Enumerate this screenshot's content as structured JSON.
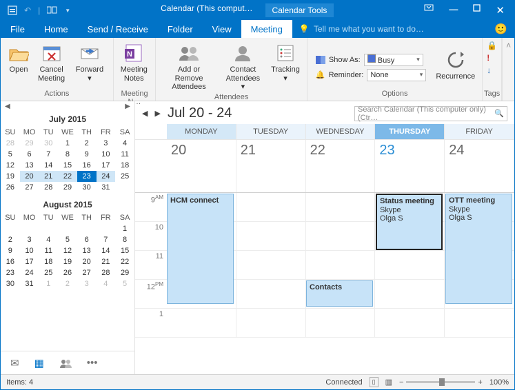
{
  "title": {
    "main": "Calendar (This comput…",
    "context": "Calendar Tools"
  },
  "menu": {
    "file": "File",
    "home": "Home",
    "sendreceive": "Send / Receive",
    "folder": "Folder",
    "view": "View",
    "meeting": "Meeting",
    "tell": "Tell me what you want to do…"
  },
  "ribbon": {
    "actions": {
      "label": "Actions",
      "open": "Open",
      "cancel": "Cancel\nMeeting",
      "forward": "Forward"
    },
    "notes": {
      "label": "Meeting N…",
      "meetingnotes": "Meeting\nNotes"
    },
    "attendees": {
      "label": "Attendees",
      "addremove": "Add or Remove\nAttendees",
      "contact": "Contact\nAttendees ▾",
      "tracking": "Tracking"
    },
    "options": {
      "label": "Options",
      "showas": "Show As:",
      "showas_val": "Busy",
      "reminder": "Reminder:",
      "reminder_val": "None",
      "recurrence": "Recurrence"
    },
    "tags": {
      "label": "Tags"
    }
  },
  "cal": {
    "month1": "July 2015",
    "dow": [
      "SU",
      "MO",
      "TU",
      "WE",
      "TH",
      "FR",
      "SA"
    ],
    "m1": [
      [
        "28",
        "29",
        "30",
        "1",
        "2",
        "3",
        "4"
      ],
      [
        "5",
        "6",
        "7",
        "8",
        "9",
        "10",
        "11"
      ],
      [
        "12",
        "13",
        "14",
        "15",
        "16",
        "17",
        "18"
      ],
      [
        "19",
        "20",
        "21",
        "22",
        "23",
        "24",
        "25"
      ],
      [
        "26",
        "27",
        "28",
        "29",
        "30",
        "31",
        ""
      ]
    ],
    "month2": "August 2015",
    "m2": [
      [
        "",
        "",
        "",
        "",
        "",
        "",
        "1"
      ],
      [
        "2",
        "3",
        "4",
        "5",
        "6",
        "7",
        "8"
      ],
      [
        "9",
        "10",
        "11",
        "12",
        "13",
        "14",
        "15"
      ],
      [
        "16",
        "17",
        "18",
        "19",
        "20",
        "21",
        "22"
      ],
      [
        "23",
        "24",
        "25",
        "26",
        "27",
        "28",
        "29"
      ],
      [
        "30",
        "31",
        "1",
        "2",
        "3",
        "4",
        "5"
      ]
    ]
  },
  "view": {
    "range": "Jul 20 - 24",
    "search": "Search Calendar (This computer only) (Ctr…",
    "days": [
      "MONDAY",
      "TUESDAY",
      "WEDNESDAY",
      "THURSDAY",
      "FRIDAY"
    ],
    "dates": [
      "20",
      "21",
      "22",
      "23",
      "24"
    ],
    "hours": [
      "9",
      "10",
      "11",
      "12",
      "1"
    ],
    "ampm": [
      "AM",
      "",
      "",
      "PM",
      ""
    ]
  },
  "events": {
    "hcm": {
      "title": "HCM connect"
    },
    "status": {
      "title": "Status meeting",
      "loc": "Skype",
      "who": "Olga S"
    },
    "ott": {
      "title": "OTT meeting",
      "loc": "Skype",
      "who": "Olga S"
    },
    "contacts": {
      "title": "Contacts"
    }
  },
  "status": {
    "items": "Items: 4",
    "conn": "Connected",
    "zoom": "100%"
  }
}
